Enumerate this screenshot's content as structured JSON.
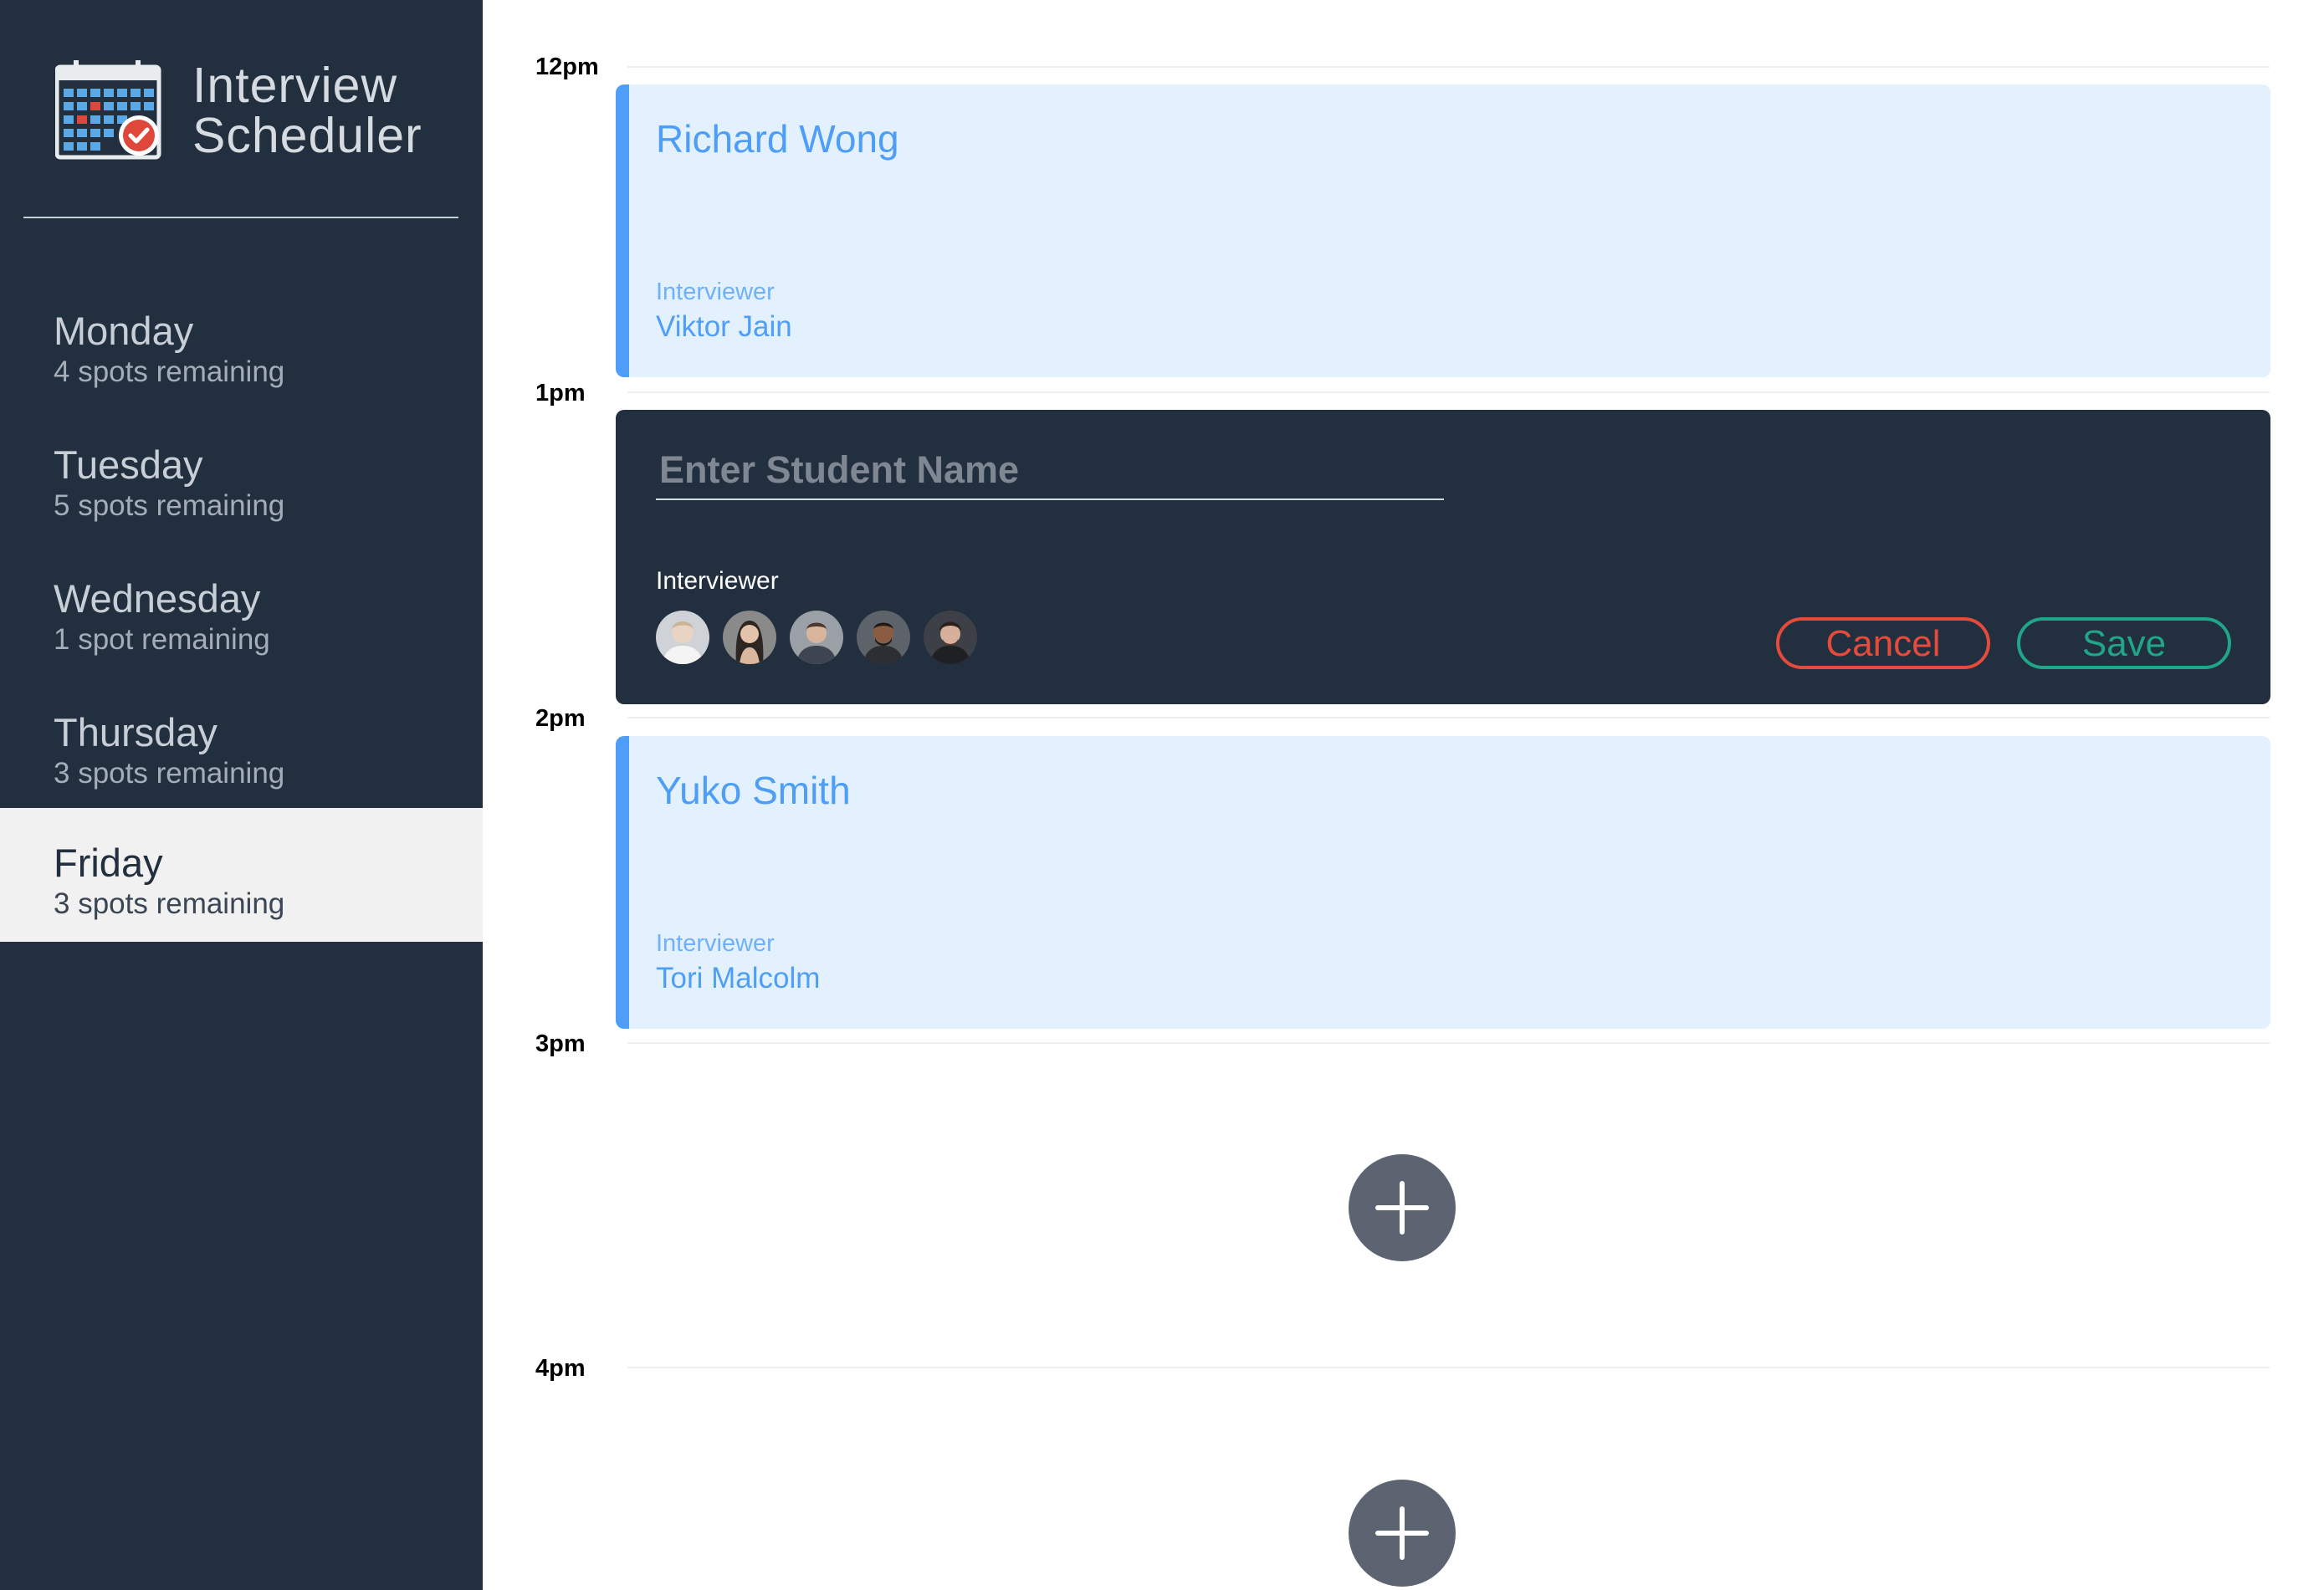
{
  "sidebar": {
    "brand": {
      "line1": "Interview",
      "line2": "Scheduler",
      "icon": "calendar-check-icon"
    },
    "days": [
      {
        "name": "Monday",
        "spots": "4 spots remaining",
        "selected": false
      },
      {
        "name": "Tuesday",
        "spots": "5 spots remaining",
        "selected": false
      },
      {
        "name": "Wednesday",
        "spots": "1 spot remaining",
        "selected": false
      },
      {
        "name": "Thursday",
        "spots": "3 spots remaining",
        "selected": false
      },
      {
        "name": "Friday",
        "spots": "3 spots remaining",
        "selected": true
      }
    ]
  },
  "schedule": {
    "times": [
      "12pm",
      "1pm",
      "2pm",
      "3pm",
      "4pm"
    ],
    "appointments": [
      {
        "time": "12pm",
        "student": "Richard Wong",
        "interviewer_label": "Interviewer",
        "interviewer": "Viktor Jain"
      },
      {
        "time": "2pm",
        "student": "Yuko Smith",
        "interviewer_label": "Interviewer",
        "interviewer": "Tori Malcolm"
      }
    ],
    "form": {
      "time": "1pm",
      "student_placeholder": "Enter Student Name",
      "student_value": "",
      "interviewer_label": "Interviewer",
      "avatars": [
        "avatar-1",
        "avatar-2",
        "avatar-3",
        "avatar-4",
        "avatar-5"
      ],
      "cancel_label": "Cancel",
      "save_label": "Save"
    },
    "add_buttons": [
      {
        "time": "3pm",
        "icon": "plus-icon"
      },
      {
        "time": "4pm",
        "icon": "plus-icon"
      }
    ]
  },
  "colors": {
    "sidebar_bg": "#222f3e",
    "selected_day_bg": "#f1f1f1",
    "appointment_bg": "#e3f0fe",
    "appointment_accent": "#4e9ef7",
    "cancel": "#e64a3b",
    "save": "#21a58a",
    "add_button": "#5b6470"
  }
}
